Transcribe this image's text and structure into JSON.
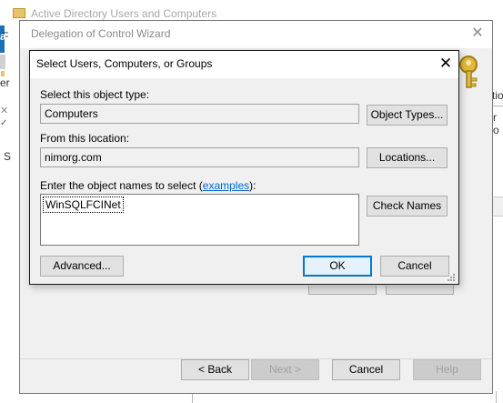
{
  "background_window": {
    "title": "Active Directory Users and Computers",
    "fragments": [
      "F",
      "a",
      "er",
      "S",
      "tio",
      "r o"
    ]
  },
  "wizard": {
    "title": "Delegation of Control Wizard",
    "close_glyph": "✕",
    "buttons": {
      "back": "< Back",
      "next": "Next >",
      "cancel": "Cancel",
      "help": "Help"
    }
  },
  "dialog": {
    "title": "Select Users, Computers, or Groups",
    "close_glyph": "✕",
    "object_type_label": "Select this object type:",
    "object_type_value": "Computers",
    "object_types_button": "Object Types...",
    "location_label": "From this location:",
    "location_value": "nimorg.com",
    "locations_button": "Locations...",
    "names_label_prefix": "Enter the object names to select (",
    "names_label_link": "examples",
    "names_label_suffix": "):",
    "names_value": "WinSQLFCINet",
    "check_names_button": "Check Names",
    "advanced_button": "Advanced...",
    "ok_button": "OK",
    "cancel_button": "Cancel"
  },
  "colors": {
    "accent": "#0078d7",
    "link": "#0066cc",
    "dialog_bg": "#f0f0f0"
  }
}
